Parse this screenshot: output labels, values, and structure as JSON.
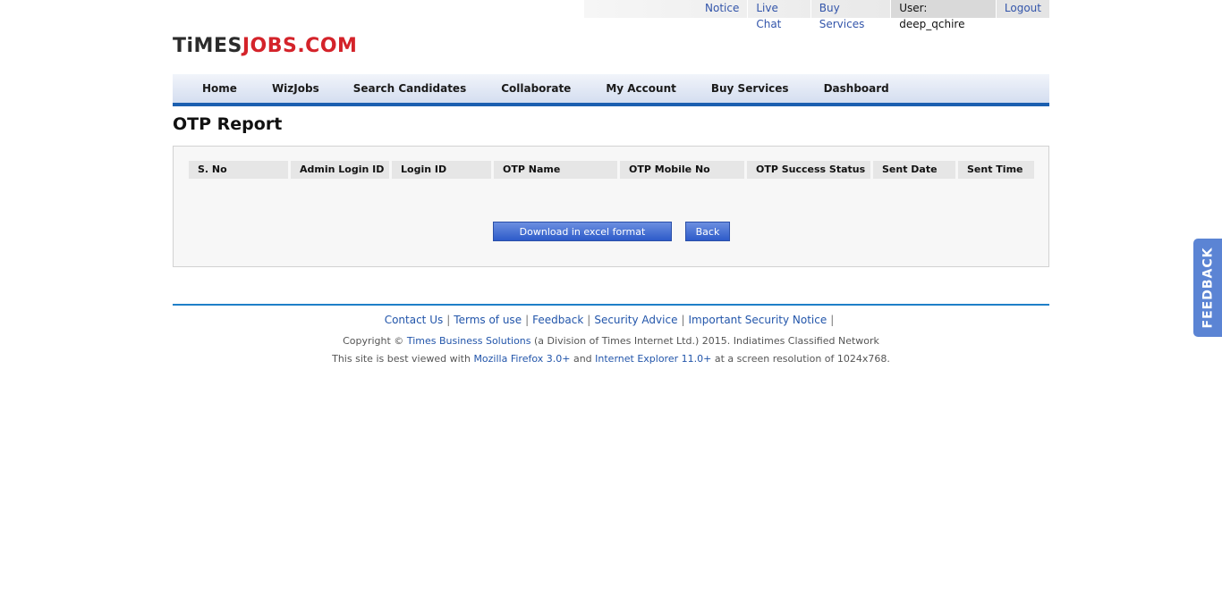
{
  "topbar": {
    "links": [
      "Notice",
      "Live Chat",
      "Buy Services"
    ],
    "user_label": "User: deep_qchire",
    "logout": "Logout"
  },
  "logo": {
    "part1": "TiMES",
    "part2": "JOBS.COM"
  },
  "nav": {
    "items": [
      "Home",
      "WizJobs",
      "Search Candidates",
      "Collaborate",
      "My Account",
      "Buy Services",
      "Dashboard"
    ]
  },
  "page": {
    "title": "OTP Report"
  },
  "table": {
    "columns": [
      "S. No",
      "Admin Login ID",
      "Login ID",
      "OTP Name",
      "OTP Mobile No",
      "OTP Success Status",
      "Sent Date",
      "Sent Time"
    ],
    "rows": []
  },
  "buttons": {
    "download": "Download in excel format",
    "back": "Back"
  },
  "footer": {
    "links": [
      "Contact Us",
      "Terms of use",
      "Feedback",
      "Security Advice",
      "Important Security Notice"
    ],
    "sep": "|",
    "copy_pre": "Copyright © ",
    "copy_link": "Times Business Solutions",
    "copy_post": " (a Division of Times Internet Ltd.) 2015. Indiatimes Classified Network",
    "best_pre": "This site is best viewed with ",
    "best_link1": "Mozilla Firefox 3.0+",
    "best_mid": " and ",
    "best_link2": "Internet Explorer 11.0+",
    "best_post": " at a screen resolution of 1024x768."
  },
  "feedback_tab": "FEEDBACK"
}
